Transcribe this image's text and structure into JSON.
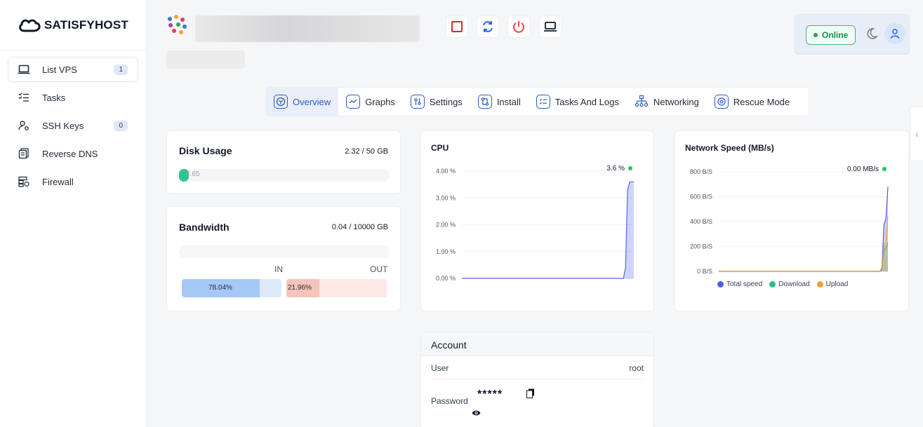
{
  "sidebar": {
    "brand": "SATISFYHOST",
    "items": [
      {
        "label": "List VPS",
        "badge": "1",
        "icon": "laptop-icon"
      },
      {
        "label": "Tasks",
        "badge": null,
        "icon": "checklist-icon"
      },
      {
        "label": "SSH Keys",
        "badge": "0",
        "icon": "user-key-icon"
      },
      {
        "label": "Reverse DNS",
        "badge": null,
        "icon": "dns-icon"
      },
      {
        "label": "Firewall",
        "badge": null,
        "icon": "firewall-icon"
      }
    ]
  },
  "header": {
    "status": "Online",
    "controls": [
      "stop-icon",
      "restart-icon",
      "power-icon",
      "console-icon"
    ]
  },
  "tabs": [
    {
      "label": "Overview",
      "active": true
    },
    {
      "label": "Graphs",
      "active": false
    },
    {
      "label": "Settings",
      "active": false
    },
    {
      "label": "Install",
      "active": false
    },
    {
      "label": "Tasks And Logs",
      "active": false
    },
    {
      "label": "Networking",
      "active": false
    },
    {
      "label": "Rescue Mode",
      "active": false
    }
  ],
  "disk": {
    "title": "Disk Usage",
    "value": "2.32 / 50 GB",
    "percent_label": "4.65",
    "fraction": 0.0465
  },
  "bandwidth": {
    "title": "Bandwidth",
    "value": "0.04 / 10000 GB",
    "in_label": "IN",
    "out_label": "OUT",
    "in_percent": "78.04%",
    "out_percent": "21.96%",
    "in_fraction": 0.7804,
    "out_fraction": 0.2196
  },
  "chart_data": [
    {
      "type": "area",
      "title": "CPU",
      "current": "3.6 %",
      "y_ticks": [
        "4.00 %",
        "3.00 %",
        "2.00 %",
        "1.00 %",
        "0.00 %"
      ],
      "ylim": [
        0,
        4
      ],
      "grid": true,
      "series": [
        {
          "values": [
            0,
            0,
            0,
            0,
            0,
            0,
            0,
            0,
            0,
            0,
            0,
            0,
            0,
            0,
            0,
            0,
            0,
            0,
            0,
            0,
            0,
            0,
            0,
            0,
            0,
            0,
            0,
            0,
            0,
            0,
            0,
            0,
            0,
            0,
            0,
            0,
            0,
            0,
            0,
            0,
            0,
            0,
            0,
            0,
            0,
            0,
            0,
            0,
            0,
            0,
            0,
            0,
            0,
            0,
            0,
            0,
            0,
            0,
            0,
            0,
            0,
            0,
            0,
            0,
            0,
            0,
            0,
            0,
            0,
            0,
            0,
            0,
            0,
            0,
            0,
            0,
            0,
            0,
            0,
            0.4,
            3.3,
            3.6,
            3.6,
            3.6
          ],
          "color": "#5468e8"
        }
      ]
    },
    {
      "type": "area",
      "title": "Network Speed (MB/s)",
      "current": "0.00 MB/s",
      "y_ticks": [
        "800 B/S",
        "600 B/S",
        "400 B/S",
        "200 B/S",
        "0 B/S"
      ],
      "ylim": [
        0,
        800
      ],
      "grid": true,
      "legend_position": "bottom",
      "series": [
        {
          "name": "Total speed",
          "values": [
            0,
            0,
            0,
            0,
            0,
            0,
            0,
            0,
            0,
            0,
            0,
            0,
            0,
            0,
            0,
            0,
            0,
            0,
            0,
            0,
            0,
            0,
            0,
            0,
            0,
            0,
            0,
            0,
            0,
            0,
            0,
            0,
            0,
            0,
            0,
            0,
            0,
            0,
            0,
            0,
            0,
            0,
            0,
            0,
            0,
            0,
            0,
            0,
            0,
            0,
            0,
            0,
            0,
            0,
            0,
            0,
            0,
            0,
            0,
            0,
            0,
            0,
            0,
            0,
            0,
            0,
            0,
            0,
            0,
            0,
            0,
            0,
            0,
            0,
            0,
            0,
            0,
            0,
            0,
            0,
            0,
            0,
            0,
            30,
            380,
            420,
            680
          ],
          "color": "#4b5ee6"
        },
        {
          "name": "Download",
          "values": [
            0,
            0,
            0,
            0,
            0,
            0,
            0,
            0,
            0,
            0,
            0,
            0,
            0,
            0,
            0,
            0,
            0,
            0,
            0,
            0,
            0,
            0,
            0,
            0,
            0,
            0,
            0,
            0,
            0,
            0,
            0,
            0,
            0,
            0,
            0,
            0,
            0,
            0,
            0,
            0,
            0,
            0,
            0,
            0,
            0,
            0,
            0,
            0,
            0,
            0,
            0,
            0,
            0,
            0,
            0,
            0,
            0,
            0,
            0,
            0,
            0,
            0,
            0,
            0,
            0,
            0,
            0,
            0,
            0,
            0,
            0,
            0,
            0,
            0,
            0,
            0,
            0,
            0,
            0,
            0,
            0,
            0,
            0,
            15,
            170,
            190,
            230
          ],
          "color": "#27c17b"
        },
        {
          "name": "Upload",
          "values": [
            0,
            0,
            0,
            0,
            0,
            0,
            0,
            0,
            0,
            0,
            0,
            0,
            0,
            0,
            0,
            0,
            0,
            0,
            0,
            0,
            0,
            0,
            0,
            0,
            0,
            0,
            0,
            0,
            0,
            0,
            0,
            0,
            0,
            0,
            0,
            0,
            0,
            0,
            0,
            0,
            0,
            0,
            0,
            0,
            0,
            0,
            0,
            0,
            0,
            0,
            0,
            0,
            0,
            0,
            0,
            0,
            0,
            0,
            0,
            0,
            0,
            0,
            0,
            0,
            0,
            0,
            0,
            0,
            0,
            0,
            0,
            0,
            0,
            0,
            0,
            0,
            0,
            0,
            0,
            0,
            0,
            0,
            0,
            15,
            210,
            230,
            450
          ],
          "color": "#f59e32"
        }
      ]
    }
  ],
  "account": {
    "title": "Account",
    "user_label": "User",
    "user_value": "root",
    "password_label": "Password",
    "password_mask": "*****"
  },
  "colors": {
    "accent": "#2a5cc5",
    "online": "#22a35b",
    "disk_fill": "#2fc58e",
    "in_fill": "#a6c8f5",
    "out_fill": "#f5c4ba"
  }
}
